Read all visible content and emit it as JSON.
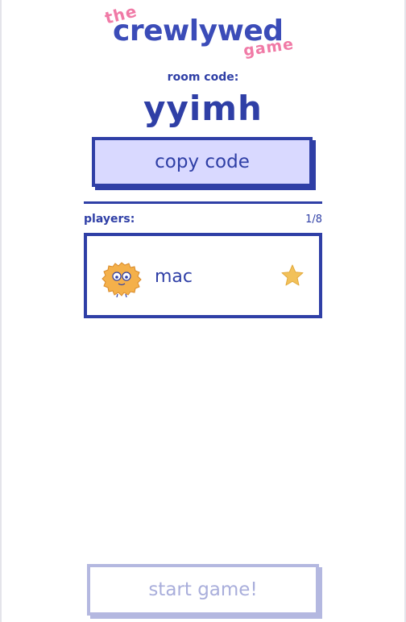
{
  "logo": {
    "the": "the",
    "main": "crewlywed",
    "game": "game"
  },
  "room": {
    "label": "room code:",
    "code": "yyimh"
  },
  "copy_button": {
    "label": "copy code"
  },
  "players": {
    "label": "players:",
    "count": "1/8",
    "list": [
      {
        "name": "mac",
        "is_host": true,
        "avatar": "orange-fuzzy-monster-icon"
      }
    ]
  },
  "start_button": {
    "label": "start game!",
    "enabled": false
  },
  "colors": {
    "primary": "#2f3fa6",
    "accent_pink": "#f07aa6",
    "button_fill": "#d9d9ff",
    "disabled": "#b4b8e0",
    "star": "#f2c15a",
    "avatar": "#f4b04a"
  }
}
